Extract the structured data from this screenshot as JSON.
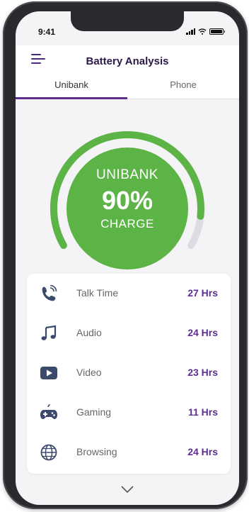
{
  "status": {
    "time": "9:41"
  },
  "header": {
    "title": "Battery Analysis",
    "menu_icon": "hamburger-menu-icon"
  },
  "tabs": [
    {
      "label": "Unibank",
      "active": true
    },
    {
      "label": "Phone",
      "active": false
    }
  ],
  "gauge": {
    "line1": "UNIBANK",
    "line2": "90%",
    "line3": "CHARGE",
    "level": 0.9,
    "color": "#5db446",
    "track": "#dcdce4"
  },
  "stats": [
    {
      "icon": "phone-call-icon",
      "label": "Talk Time",
      "value": "27 Hrs"
    },
    {
      "icon": "music-note-icon",
      "label": "Audio",
      "value": "24 Hrs"
    },
    {
      "icon": "video-play-icon",
      "label": "Video",
      "value": "23 Hrs"
    },
    {
      "icon": "gamepad-icon",
      "label": "Gaming",
      "value": "11 Hrs"
    },
    {
      "icon": "globe-icon",
      "label": "Browsing",
      "value": "24 Hrs"
    }
  ],
  "colors": {
    "accent": "#5c2f8e",
    "icon": "#3b4a6b"
  }
}
